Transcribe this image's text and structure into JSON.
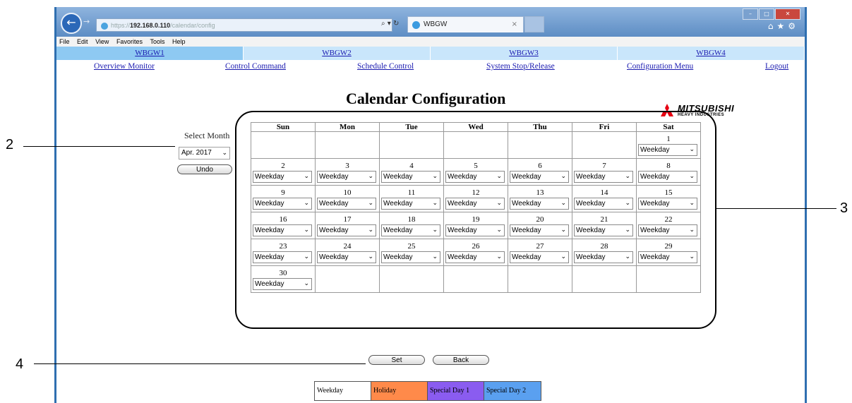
{
  "browser": {
    "address": {
      "prefix": "https://",
      "host": "192.168.0.110",
      "path": "/calendar/config"
    },
    "address_tools": "⌕ ▾ ↻",
    "tab_title": "WBGW",
    "tab_close": "×",
    "controls": {
      "minimize": "–",
      "maximize": "□",
      "close": "✕"
    },
    "right_icons": "⌂★⚙",
    "menu": [
      "File",
      "Edit",
      "View",
      "Favorites",
      "Tools",
      "Help"
    ]
  },
  "gateway_tabs": [
    "WBGW1",
    "WBGW2",
    "WBGW3",
    "WBGW4"
  ],
  "nav": {
    "overview": "Overview Monitor",
    "control": "Control Command",
    "schedule": "Schedule Control",
    "stop": "System Stop/Release",
    "config": "Configuration Menu",
    "logout": "Logout"
  },
  "page_title": "Calendar Configuration",
  "logo": {
    "name": "MITSUBISHI",
    "sub": "HEAVY INDUSTRIES",
    "color": "#e60012"
  },
  "select_month": {
    "label": "Select Month",
    "value": "Apr. 2017"
  },
  "buttons": {
    "undo": "Undo",
    "set": "Set",
    "back": "Back"
  },
  "calendar": {
    "headers": [
      "Sun",
      "Mon",
      "Tue",
      "Wed",
      "Thu",
      "Fri",
      "Sat"
    ],
    "weeks": [
      [
        "",
        "",
        "",
        "",
        "",
        "",
        "1"
      ],
      [
        "2",
        "3",
        "4",
        "5",
        "6",
        "7",
        "8"
      ],
      [
        "9",
        "10",
        "11",
        "12",
        "13",
        "14",
        "15"
      ],
      [
        "16",
        "17",
        "18",
        "19",
        "20",
        "21",
        "22"
      ],
      [
        "23",
        "24",
        "25",
        "26",
        "27",
        "28",
        "29"
      ],
      [
        "30",
        "",
        "",
        "",
        "",
        "",
        ""
      ]
    ],
    "day_type": "Weekday"
  },
  "legend": [
    {
      "label": "Weekday",
      "color": "#ffffff"
    },
    {
      "label": "Holiday",
      "color": "#ff8a4a"
    },
    {
      "label": "Special Day 1",
      "color": "#8a5cf0"
    },
    {
      "label": "Special Day 2",
      "color": "#5aa0f0"
    }
  ],
  "callouts": {
    "n2": "2",
    "n3": "3",
    "n4": "4"
  }
}
